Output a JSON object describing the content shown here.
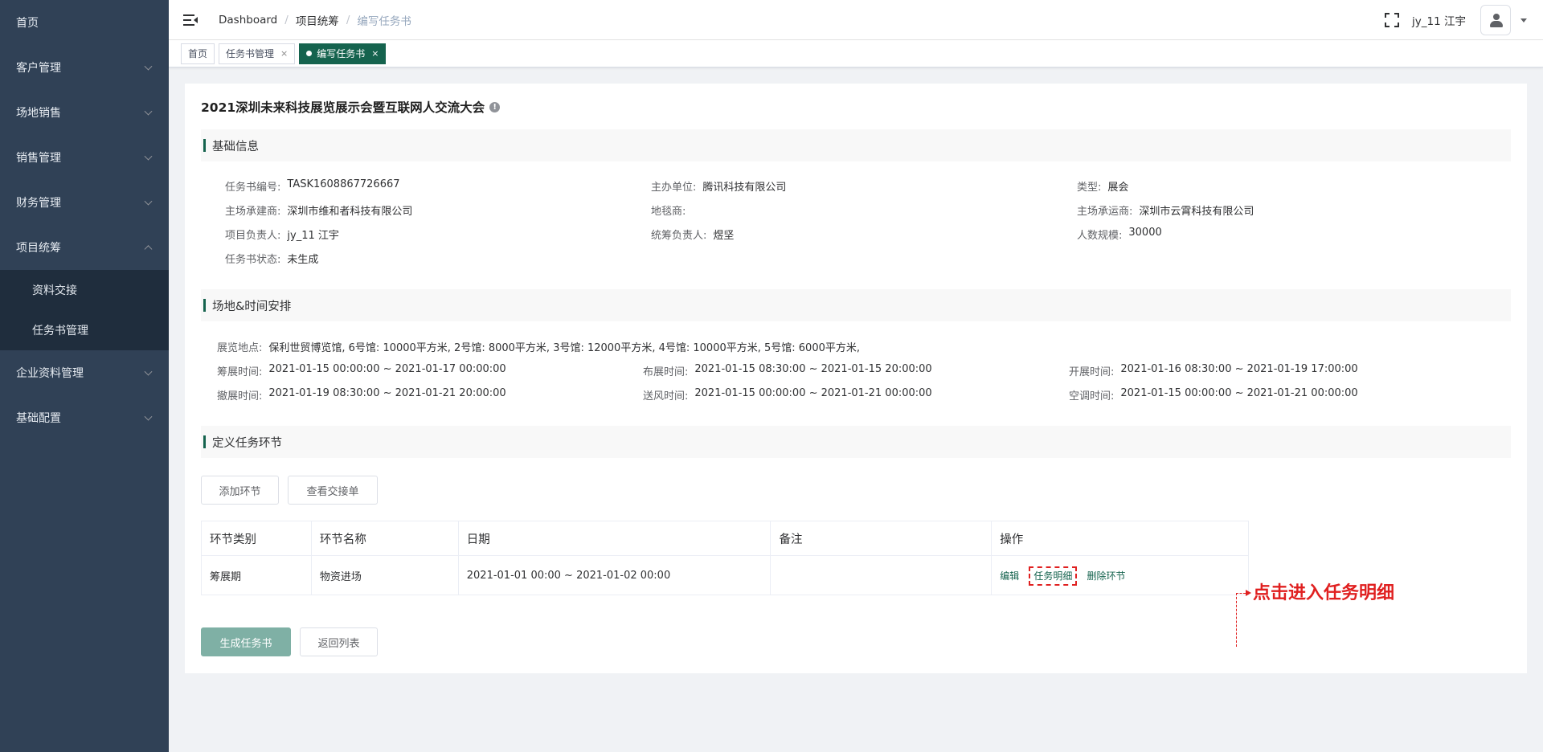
{
  "sidebar": {
    "items": [
      {
        "label": "首页",
        "chevron": false
      },
      {
        "label": "客户管理",
        "chevron": true
      },
      {
        "label": "场地销售",
        "chevron": true
      },
      {
        "label": "销售管理",
        "chevron": true
      },
      {
        "label": "财务管理",
        "chevron": true
      },
      {
        "label": "项目统筹",
        "chevron": true,
        "open": true
      },
      {
        "label": "企业资料管理",
        "chevron": true
      },
      {
        "label": "基础配置",
        "chevron": true
      }
    ],
    "sub_items": [
      {
        "label": "资料交接"
      },
      {
        "label": "任务书管理"
      }
    ]
  },
  "header": {
    "breadcrumb": [
      "Dashboard",
      "项目统筹",
      "编写任务书"
    ],
    "username": "jy_11 江宇"
  },
  "tags": [
    {
      "label": "首页"
    },
    {
      "label": "任务书管理",
      "close": "×"
    },
    {
      "label": "编写任务书",
      "close": "×",
      "active": true
    }
  ],
  "page": {
    "title": "2021深圳未来科技展览展示会暨互联网人交流大会",
    "info_icon": "!"
  },
  "sections": {
    "basic": "基础信息",
    "venue": "场地&时间安排",
    "define": "定义任务环节"
  },
  "basic_info": {
    "task_no_label": "任务书编号:",
    "task_no": "TASK1608867726667",
    "organizer_label": "主办单位:",
    "organizer": "腾讯科技有限公司",
    "type_label": "类型:",
    "type": "展会",
    "builder_label": "主场承建商:",
    "builder": "深圳市维和者科技有限公司",
    "carpet_label": "地毯商:",
    "carpet": "",
    "transport_label": "主场承运商:",
    "transport": "深圳市云霄科技有限公司",
    "pm_label": "项目负责人:",
    "pm": "jy_11 江宇",
    "coord_label": "统筹负责人:",
    "coord": "煜坚",
    "scale_label": "人数规模:",
    "scale": "30000",
    "status_label": "任务书状态:",
    "status": "未生成"
  },
  "venue_info": {
    "location_label": "展览地点:",
    "location": "保利世贸博览馆, 6号馆: 10000平方米, 2号馆: 8000平方米, 3号馆: 12000平方米, 4号馆: 10000平方米, 5号馆: 6000平方米,",
    "prep_label": "筹展时间:",
    "prep": "2021-01-15 00:00:00 ~ 2021-01-17 00:00:00",
    "setup_label": "布展时间:",
    "setup": "2021-01-15 08:30:00 ~ 2021-01-15 20:00:00",
    "open_label": "开展时间:",
    "open": "2021-01-16 08:30:00 ~ 2021-01-19 17:00:00",
    "teardown_label": "撤展时间:",
    "teardown": "2021-01-19 08:30:00 ~ 2021-01-21 20:00:00",
    "air_label": "送风时间:",
    "air": "2021-01-15 00:00:00 ~ 2021-01-21 00:00:00",
    "ac_label": "空调时间:",
    "ac": "2021-01-15 00:00:00 ~ 2021-01-21 00:00:00"
  },
  "actions": {
    "add_stage": "添加环节",
    "view_handover": "查看交接单",
    "generate": "生成任务书",
    "back": "返回列表"
  },
  "table": {
    "headers": [
      "环节类别",
      "环节名称",
      "日期",
      "备注",
      "操作"
    ],
    "rows": [
      {
        "category": "筹展期",
        "name": "物资进场",
        "date": "2021-01-01 00:00 ~ 2021-01-02 00:00",
        "note": "",
        "ops": [
          "编辑",
          "任务明细",
          "删除环节"
        ]
      }
    ]
  },
  "annotation": {
    "text": "点击进入任务明细",
    "color": "#e02020"
  },
  "colors": {
    "sidebar_bg": "#304156",
    "accent": "#15634e",
    "primary_btn": "#7fb0a5"
  }
}
